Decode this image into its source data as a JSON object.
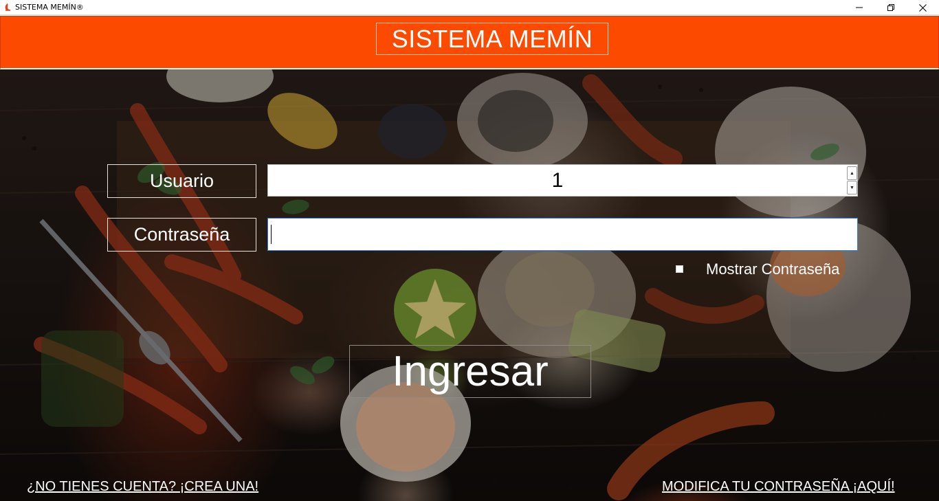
{
  "window": {
    "title": "SISTEMA MEMÍN®",
    "icon": "app-logo-icon",
    "controls": [
      "minimize-icon",
      "maximize-icon",
      "close-icon"
    ]
  },
  "header": {
    "title": "SISTEMA MEMÍN",
    "background_color": "#fc4a00"
  },
  "form": {
    "user_label": "Usuario",
    "user_value": "1",
    "password_label": "Contraseña",
    "password_value": "",
    "show_password_label": "Mostrar Contraseña",
    "show_password_checked": false,
    "login_label": "Ingresar"
  },
  "links": {
    "create_account": "¿NO TIENES CUENTA? ¡CREA UNA!",
    "modify_password": "MODIFICA TU CONTRASEÑA ¡AQUÍ!"
  },
  "colors": {
    "accent": "#fc4a00",
    "input_focus_border": "#2f7fd6",
    "text_on_image": "#ffffff"
  }
}
